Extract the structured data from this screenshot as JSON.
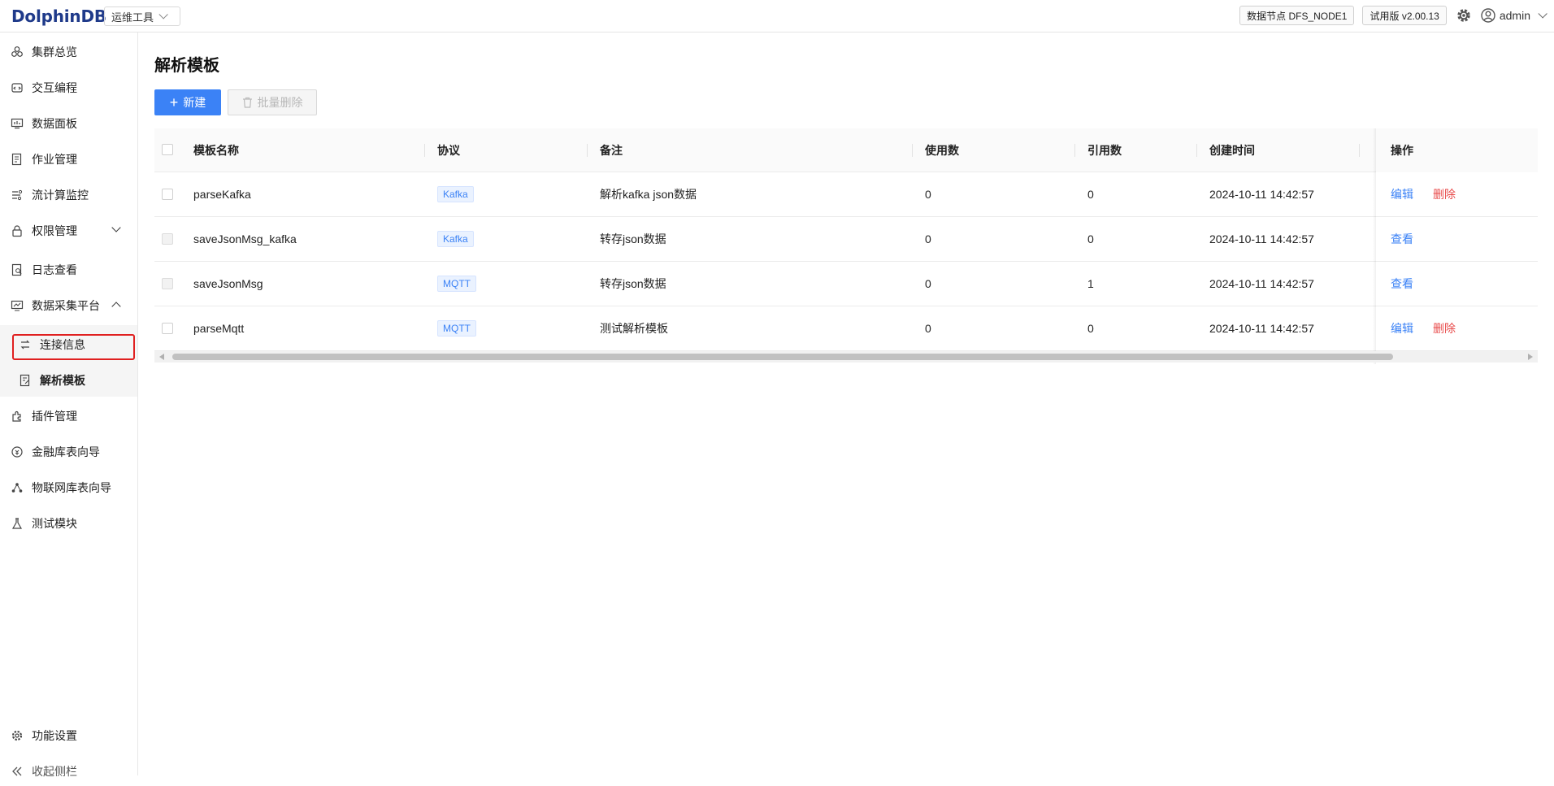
{
  "header": {
    "logo": "DolphinDB",
    "tool_select": "运维工具",
    "node_badge": "数据节点 DFS_NODE1",
    "version_badge": "试用版 v2.00.13",
    "user": "admin"
  },
  "sidebar": {
    "items": [
      {
        "label": "集群总览",
        "icon": "cluster-icon"
      },
      {
        "label": "交互编程",
        "icon": "code-icon"
      },
      {
        "label": "数据面板",
        "icon": "dashboard-icon"
      },
      {
        "label": "作业管理",
        "icon": "job-icon"
      },
      {
        "label": "流计算监控",
        "icon": "stream-icon"
      },
      {
        "label": "权限管理",
        "icon": "lock-icon"
      },
      {
        "label": "日志查看",
        "icon": "log-icon"
      },
      {
        "label": "数据采集平台",
        "icon": "collect-icon"
      },
      {
        "label": "插件管理",
        "icon": "plugin-icon"
      },
      {
        "label": "金融库表向导",
        "icon": "finance-icon"
      },
      {
        "label": "物联网库表向导",
        "icon": "iot-icon"
      },
      {
        "label": "测试模块",
        "icon": "flask-icon"
      }
    ],
    "sub_items": [
      {
        "label": "连接信息",
        "icon": "connection-icon"
      },
      {
        "label": "解析模板",
        "icon": "template-icon"
      }
    ],
    "bottom": {
      "settings": "功能设置",
      "collapse": "收起侧栏"
    }
  },
  "main": {
    "title": "解析模板",
    "new_button": "新建",
    "batch_delete_button": "批量删除",
    "table": {
      "columns": [
        "模板名称",
        "协议",
        "备注",
        "使用数",
        "引用数",
        "创建时间",
        "操作"
      ],
      "rows": [
        {
          "name": "parseKafka",
          "protocol": "Kafka",
          "note": "解析kafka json数据",
          "usage": "0",
          "refs": "0",
          "created": "2024-10-11 14:42:57",
          "ops": [
            "编辑",
            "删除"
          ]
        },
        {
          "name": "saveJsonMsg_kafka",
          "protocol": "Kafka",
          "note": "转存json数据",
          "usage": "0",
          "refs": "0",
          "created": "2024-10-11 14:42:57",
          "ops": [
            "查看"
          ]
        },
        {
          "name": "saveJsonMsg",
          "protocol": "MQTT",
          "note": "转存json数据",
          "usage": "0",
          "refs": "1",
          "created": "2024-10-11 14:42:57",
          "ops": [
            "查看"
          ]
        },
        {
          "name": "parseMqtt",
          "protocol": "MQTT",
          "note": "测试解析模板",
          "usage": "0",
          "refs": "0",
          "created": "2024-10-11 14:42:57",
          "ops": [
            "编辑",
            "删除"
          ]
        }
      ]
    }
  },
  "colors": {
    "primary": "#3b82f6",
    "danger": "#e84a4a",
    "highlight": "#e02020"
  }
}
